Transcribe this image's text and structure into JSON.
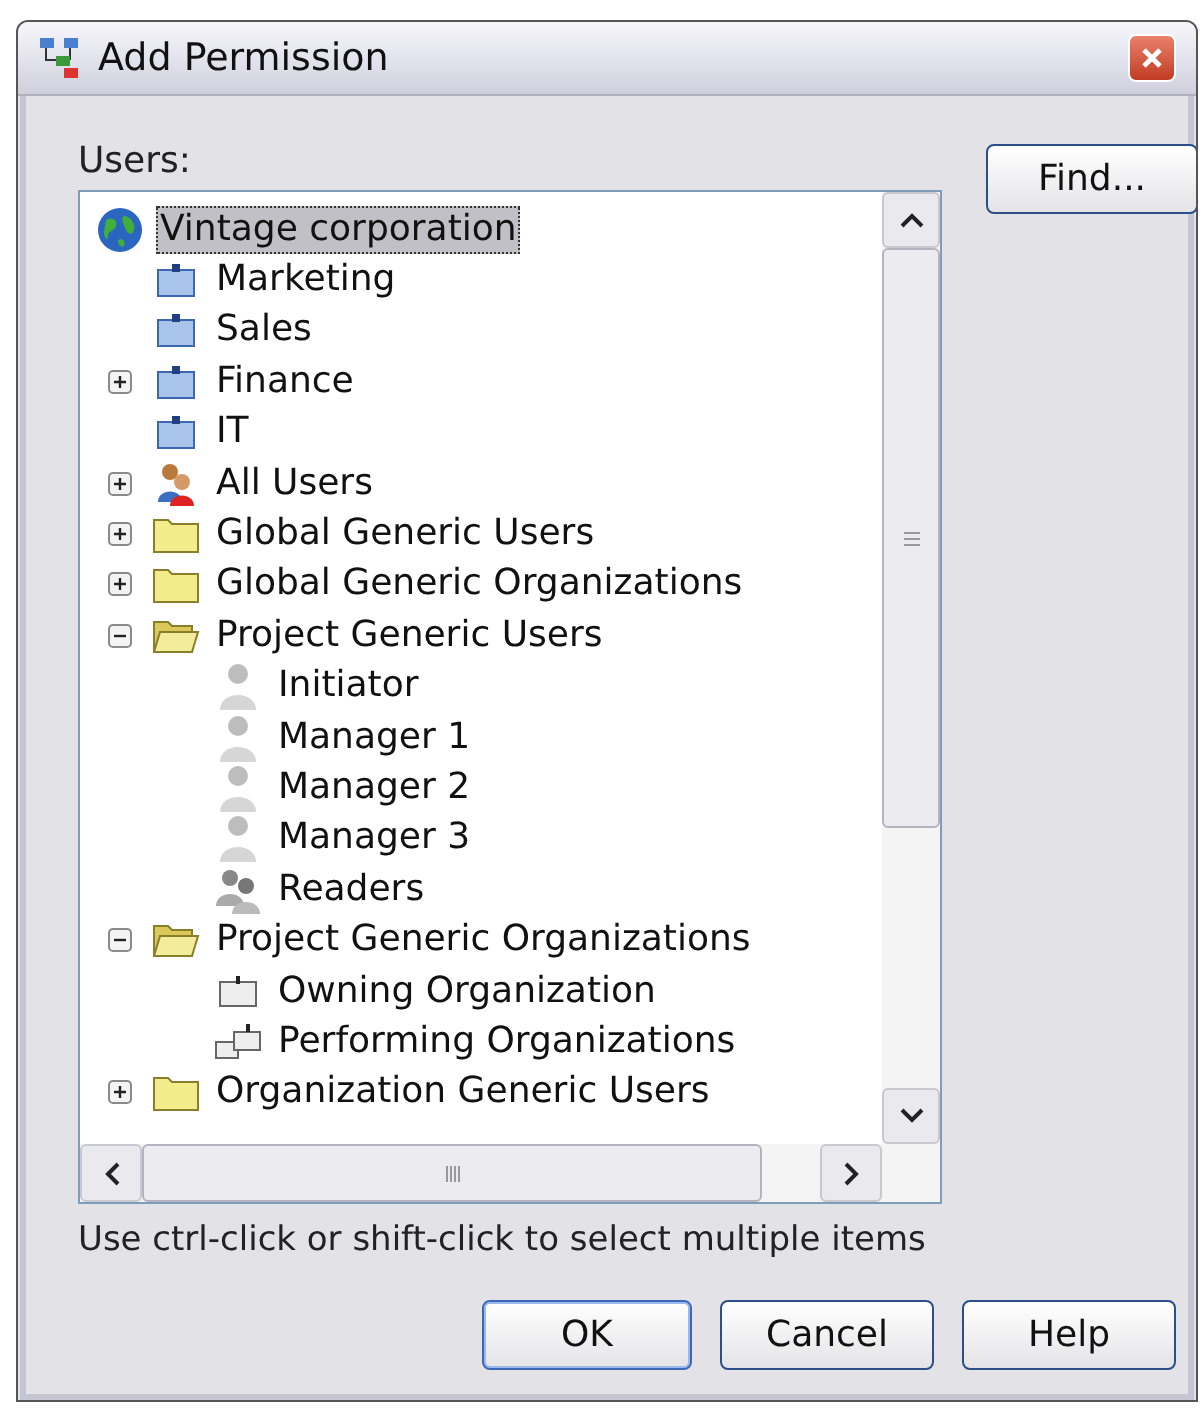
{
  "window": {
    "title": "Add Permission"
  },
  "users_label": "Users:",
  "tree": [
    {
      "label": "Vintage corporation",
      "kind": "globe",
      "selected": true,
      "children": [
        {
          "label": "Marketing",
          "kind": "org",
          "selected": false
        },
        {
          "label": "Sales",
          "kind": "org",
          "selected": false
        },
        {
          "label": "Finance",
          "kind": "org",
          "selected": false,
          "expanded": false
        },
        {
          "label": "IT",
          "kind": "org",
          "selected": false
        },
        {
          "label": "All Users",
          "kind": "users",
          "selected": false,
          "expanded": false
        },
        {
          "label": "Global Generic Users",
          "kind": "folder",
          "selected": false,
          "expanded": false
        },
        {
          "label": "Global Generic Organizations",
          "kind": "folder",
          "selected": false,
          "expanded": false
        },
        {
          "label": "Project Generic Users",
          "kind": "folder",
          "selected": false,
          "expanded": true,
          "children": [
            {
              "label": "Initiator",
              "kind": "person",
              "selected": false
            },
            {
              "label": "Manager 1",
              "kind": "person",
              "selected": false
            },
            {
              "label": "Manager 2",
              "kind": "person",
              "selected": false
            },
            {
              "label": "Manager 3",
              "kind": "person",
              "selected": false
            },
            {
              "label": "Readers",
              "kind": "group",
              "selected": false
            }
          ]
        },
        {
          "label": "Project Generic Organizations",
          "kind": "folder",
          "selected": false,
          "expanded": true,
          "children": [
            {
              "label": "Owning Organization",
              "kind": "unit",
              "selected": false
            },
            {
              "label": "Performing Organizations",
              "kind": "units",
              "selected": false
            }
          ]
        },
        {
          "label": "Organization Generic Users",
          "kind": "folder",
          "selected": false,
          "expanded": false
        }
      ]
    }
  ],
  "hint": "Use ctrl-click or shift-click to select multiple items",
  "buttons": {
    "find": "Find...",
    "ok": "OK",
    "cancel": "Cancel",
    "help": "Help"
  }
}
